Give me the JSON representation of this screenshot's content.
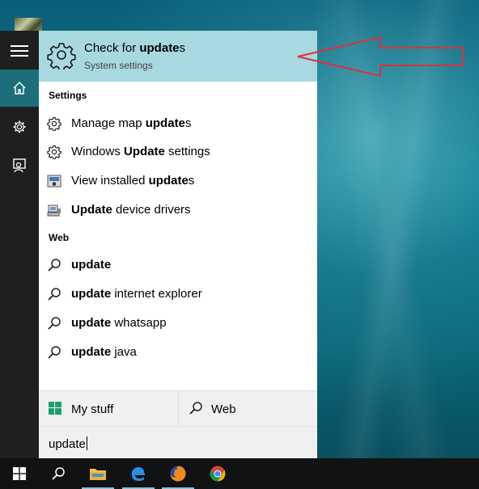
{
  "search": {
    "query": "update",
    "top_result": {
      "title_pre": "Check for ",
      "title_bold": "update",
      "title_post": "s",
      "subtitle": "System settings",
      "icon": "gear-icon"
    },
    "sections": {
      "settings_heading": "Settings",
      "web_heading": "Web"
    },
    "settings_items": [
      {
        "pre": "Manage map ",
        "bold": "update",
        "post": "s",
        "icon": "gear-icon"
      },
      {
        "pre": "Windows ",
        "bold": "Update",
        "post": " settings",
        "icon": "gear-icon"
      },
      {
        "pre": "View installed ",
        "bold": "update",
        "post": "s",
        "icon": "control-panel-icon"
      },
      {
        "pre": "",
        "bold": "Update",
        "post": " device drivers",
        "icon": "device-manager-icon"
      }
    ],
    "web_items": [
      {
        "bold": "update",
        "post": "",
        "icon": "search-icon"
      },
      {
        "bold": "update",
        "post": " internet explorer",
        "icon": "search-icon"
      },
      {
        "bold": "update",
        "post": " whatsapp",
        "icon": "search-icon"
      },
      {
        "bold": "update",
        "post": " java",
        "icon": "search-icon"
      }
    ],
    "bottom": {
      "my_stuff": "My stuff",
      "web": "Web"
    }
  },
  "rail": {
    "items": [
      "hamburger-icon",
      "home-icon",
      "gear-icon",
      "feedback-icon"
    ]
  },
  "taskbar": {
    "items": [
      "windows-start-icon",
      "search-icon",
      "file-explorer-icon",
      "edge-icon",
      "firefox-icon",
      "chrome-icon"
    ]
  },
  "colors": {
    "highlight": "#a8d8e0",
    "rail": "#1f1f1f",
    "rail_active": "#1b6e7a",
    "annotation_arrow": "#e0303a"
  }
}
